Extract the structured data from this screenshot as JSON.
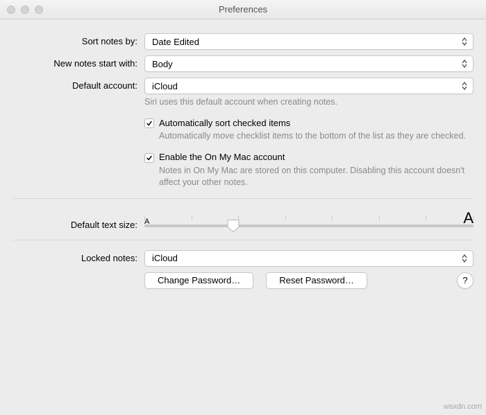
{
  "window": {
    "title": "Preferences"
  },
  "labels": {
    "sort": "Sort notes by:",
    "newNotes": "New notes start with:",
    "defaultAccount": "Default account:",
    "textSize": "Default text size:",
    "locked": "Locked notes:"
  },
  "selects": {
    "sort": "Date Edited",
    "newNotes": "Body",
    "defaultAccount": "iCloud",
    "locked": "iCloud"
  },
  "hints": {
    "defaultAccount": "Siri uses this default account when creating notes.",
    "autoSort": "Automatically move checklist items to the bottom of the list as they are checked.",
    "onMyMac": "Notes in On My Mac are stored on this computer. Disabling this account doesn't affect your other notes."
  },
  "checks": {
    "autoSort": {
      "label": "Automatically sort checked items",
      "checked": true
    },
    "onMyMac": {
      "label": "Enable the On My Mac account",
      "checked": true
    }
  },
  "slider": {
    "smallA": "A",
    "largeA": "A",
    "positionPercent": 27
  },
  "buttons": {
    "change": "Change Password…",
    "reset": "Reset Password…",
    "help": "?"
  },
  "watermark": "wsxdn.com"
}
